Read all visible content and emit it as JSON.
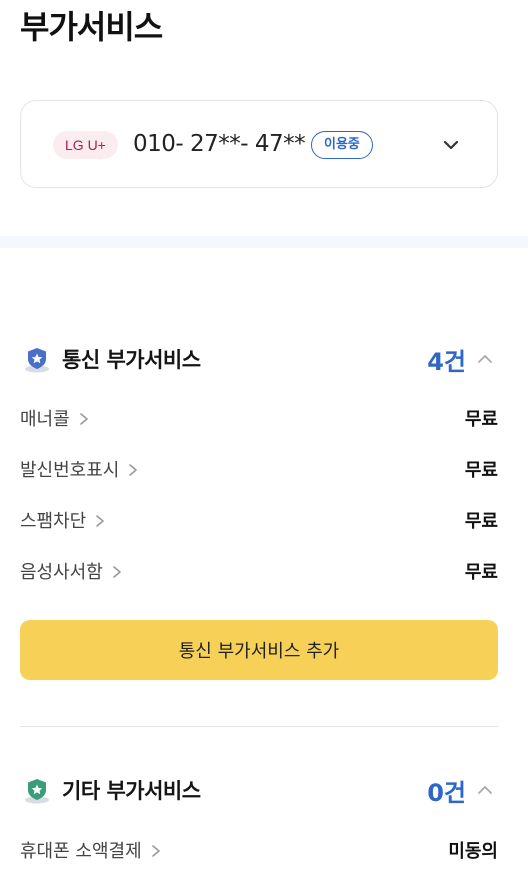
{
  "page_title": "부가서비스",
  "line": {
    "carrier_badge": "LG U+",
    "phone_number": "010- 27**- 47**",
    "status_badge": "이용중",
    "dropdown_icon": "chevron-down-icon"
  },
  "telecom_section": {
    "title": "통신 부가서비스",
    "count": "4건",
    "icon": "shield-star-icon",
    "collapse_icon": "chevron-up-icon",
    "items": [
      {
        "label": "매너콜",
        "value": "무료"
      },
      {
        "label": "발신번호표시",
        "value": "무료"
      },
      {
        "label": "스팸차단",
        "value": "무료"
      },
      {
        "label": "음성사서함",
        "value": "무료"
      }
    ],
    "add_button_label": "통신 부가서비스 추가"
  },
  "other_section": {
    "title": "기타 부가서비스",
    "count": "0건",
    "icon": "shield-star-icon",
    "collapse_icon": "chevron-up-icon",
    "items": [
      {
        "label": "휴대폰 소액결제",
        "value": "미동의"
      }
    ]
  },
  "colors": {
    "accent_blue": "#2f67c9",
    "button_yellow": "#f7d157",
    "carrier_pink": "#b21956",
    "telecom_icon": "#4a6fc9",
    "other_icon": "#3a9d7a"
  }
}
